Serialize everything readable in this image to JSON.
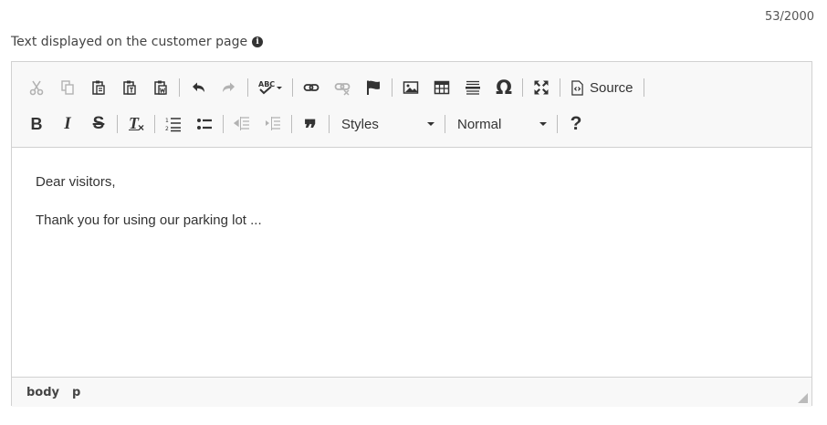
{
  "counter": "53/2000",
  "field_label": "Text displayed on the customer page",
  "toolbar": {
    "source_label": "Source",
    "styles_label": "Styles",
    "format_label": "Normal",
    "help_glyph": "?",
    "omega_glyph": "Ω",
    "bold_glyph": "B",
    "italic_glyph": "I",
    "strike_glyph": "S",
    "remove_format_glyph": "T",
    "quote_glyph": "❞",
    "spell_glyph": "ABC"
  },
  "content": {
    "paragraphs": [
      "Dear visitors,",
      "Thank you for using our parking lot ..."
    ]
  },
  "statusbar": {
    "path": [
      "body",
      "p"
    ]
  },
  "icons": {
    "toolbar_row1": [
      "cut-icon",
      "copy-icon",
      "paste-icon",
      "paste-text-icon",
      "paste-word-icon",
      "undo-icon",
      "redo-icon",
      "spellcheck-icon",
      "link-icon",
      "unlink-icon",
      "anchor-icon",
      "image-icon",
      "table-icon",
      "horizontal-rule-icon",
      "special-char-icon",
      "maximize-icon",
      "source-icon"
    ],
    "toolbar_row2": [
      "bold-icon",
      "italic-icon",
      "strikethrough-icon",
      "remove-format-icon",
      "numbered-list-icon",
      "bulleted-list-icon",
      "outdent-icon",
      "indent-icon",
      "blockquote-icon",
      "help-icon"
    ]
  }
}
